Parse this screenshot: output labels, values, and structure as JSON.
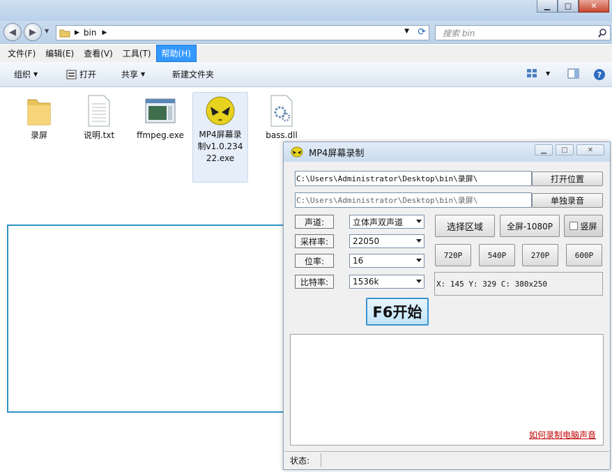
{
  "explorer": {
    "address_path": "bin",
    "search_placeholder": "搜索 bin",
    "window_buttons": {
      "minimize": "▁",
      "maximize": "□",
      "close": "✕"
    },
    "menu": [
      "文件(F)",
      "编辑(E)",
      "查看(V)",
      "工具(T)",
      "帮助(H)"
    ],
    "active_menu_index": 4,
    "toolbar": {
      "organize": "组织",
      "open": "打开",
      "share": "共享",
      "new_folder": "新建文件夹"
    },
    "files": [
      {
        "name": "录屏",
        "icon": "folder-icon"
      },
      {
        "name": "说明.txt",
        "icon": "text-file-icon"
      },
      {
        "name": "ffmpeg.exe",
        "icon": "exe-file-icon"
      },
      {
        "name": "MP4屏幕录制v1.0.23422.exe",
        "icon": "alien-app-icon"
      },
      {
        "name": "bass.dll",
        "icon": "dll-file-icon"
      }
    ],
    "selection_rect_color": "#2e93c7"
  },
  "app": {
    "title": "MP4屏幕录制",
    "path_main": "C:\\Users\\Administrator\\Desktop\\bin\\录屏\\",
    "path_audio": "C:\\Users\\Administrator\\Desktop\\bin\\录屏\\",
    "open_location_label": "打开位置",
    "audio_only_label": "单独录音",
    "select_area_label": "选择区域",
    "fullscreen_label": "全屏-1080P",
    "portrait_label": "竖屏",
    "portrait_checked": false,
    "channel_label": "声道:",
    "channel_value": "立体声双声道",
    "sample_rate_label": "采样率:",
    "sample_rate_value": "22050",
    "bit_depth_label": "位率:",
    "bit_depth_value": "16",
    "bitrate_label": "比特率:",
    "bitrate_value": "1536k",
    "res_720": "720P",
    "res_540": "540P",
    "res_270": "270P",
    "res_600": "600P",
    "coords": "X: 145 Y: 329 C: 380x250",
    "start_label": "F6开始",
    "help_link": "如何录制电脑声音",
    "status_label": "状态:",
    "status_value": ""
  }
}
